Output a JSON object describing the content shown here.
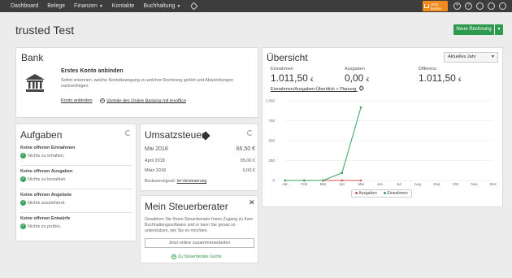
{
  "nav": {
    "items": [
      "Dashboard",
      "Belege",
      "Finanzen",
      "Kontakte",
      "Buchhaltung"
    ],
    "buy_button": "Jetzt kaufen"
  },
  "page": {
    "title": "trusted Test",
    "new_invoice_button": "Neue Rechnung"
  },
  "bank": {
    "title": "Bank",
    "heading": "Erstes Konto anbinden",
    "description": "Sofort erkennen, welche Kontobewegung zu welcher Rechnung gehört und Abweichungen nachverfolgen.",
    "link_connect": "Konto anbinden",
    "link_advantages": "Vorteile des Online Banking mit lexoffice"
  },
  "tasks": {
    "title": "Aufgaben",
    "items": [
      {
        "heading": "Keine offenen Einnahmen",
        "status": "Nichts zu erhalten."
      },
      {
        "heading": "Keine offenen Ausgaben",
        "status": "Nichts zu bezahlen."
      },
      {
        "heading": "Keine offenen Angebote",
        "status": "Nichts ausstehend."
      },
      {
        "heading": "Keine offenen Entwürfe",
        "status": "Nichts zu prüfen."
      }
    ]
  },
  "vat": {
    "title": "Umsatzsteuer",
    "rows": [
      {
        "month": "Mai 2018",
        "amount": "66,50 €"
      },
      {
        "month": "April 2018",
        "amount": "95,00 €"
      },
      {
        "month": "März 2018",
        "amount": "0,00 €"
      }
    ],
    "footer_label": "Besteuerungsart:",
    "footer_value": "Ist-Versteuerung"
  },
  "advisor": {
    "title": "Mein Steuerberater",
    "text": "Gewähren Sie Ihrem Steuerberater freien Zugang zu Ihrer Buchhaltungssoftware und er kann Sie genau so unterstützen, wie Sie es möchten.",
    "input_placeholder": "Jetzt online zusammenarbeiten",
    "search_link": "Zu Steuerberater-Suche"
  },
  "overview": {
    "title": "Übersicht",
    "year_select": "Aktuelles Jahr",
    "income_label": "Einnahmen",
    "income_value": "1.011,50",
    "expenses_label": "Ausgaben",
    "expenses_value": "0,00",
    "difference_label": "Differenz",
    "difference_value": "1.011,50",
    "currency": "€",
    "link": "Einnahmen/Ausgaben-Überblick + Planung"
  },
  "chart_data": {
    "type": "line",
    "categories": [
      "Jan",
      "Feb",
      "Mär",
      "Apr",
      "Mai",
      "Jun",
      "Jul",
      "Aug",
      "Sep",
      "Okt",
      "Nov",
      "Dez"
    ],
    "series": [
      {
        "name": "Ausgaben",
        "color": "#d9534f",
        "values": [
          0,
          0,
          0,
          0,
          0
        ]
      },
      {
        "name": "Einnahmen",
        "color": "#3aa35c",
        "values": [
          0,
          0,
          0,
          95,
          916.5
        ]
      }
    ],
    "yticks": [
      "0",
      "250",
      "500",
      "750",
      "1.000"
    ],
    "ylim": [
      0,
      1000
    ]
  }
}
